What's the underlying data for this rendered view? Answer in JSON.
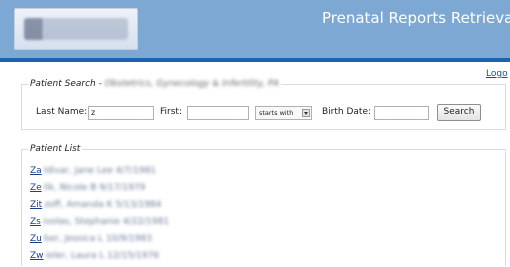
{
  "header": {
    "title": "Prenatal Reports Retrieva",
    "bg_color": "#7ea8d4",
    "rule_color": "#1f5fb4"
  },
  "logo": {
    "text": "Obstetrics Gynecology & Infertility"
  },
  "logout_label": "Logo",
  "search": {
    "legend": "Patient Search - ",
    "practice": "Obstetrics, Gynecology & Infertility, PA",
    "last_name_label": "Last Name:",
    "last_name_value": "z",
    "first_label": "First:",
    "first_value": "",
    "match_mode": "starts with",
    "birth_date_label": "Birth Date:",
    "birth_date_value": "",
    "search_button": "Search"
  },
  "patient_list": {
    "legend": "Patient List",
    "items": [
      {
        "name": "Za",
        "rest": "ldivar, Jane Lee  4/7/1981"
      },
      {
        "name": "Ze",
        "rest": "lik, Nicole B  9/17/1979"
      },
      {
        "name": "Zit",
        "rest": "zoff, Amanda K  5/13/1984"
      },
      {
        "name": "Zs",
        "rest": "ivolas, Stephanie  4/22/1981"
      },
      {
        "name": "Zu",
        "rest": "ber, Jessica L  10/9/1983"
      },
      {
        "name": "Zw",
        "rest": "ieler, Laura L  12/15/1976"
      }
    ]
  }
}
